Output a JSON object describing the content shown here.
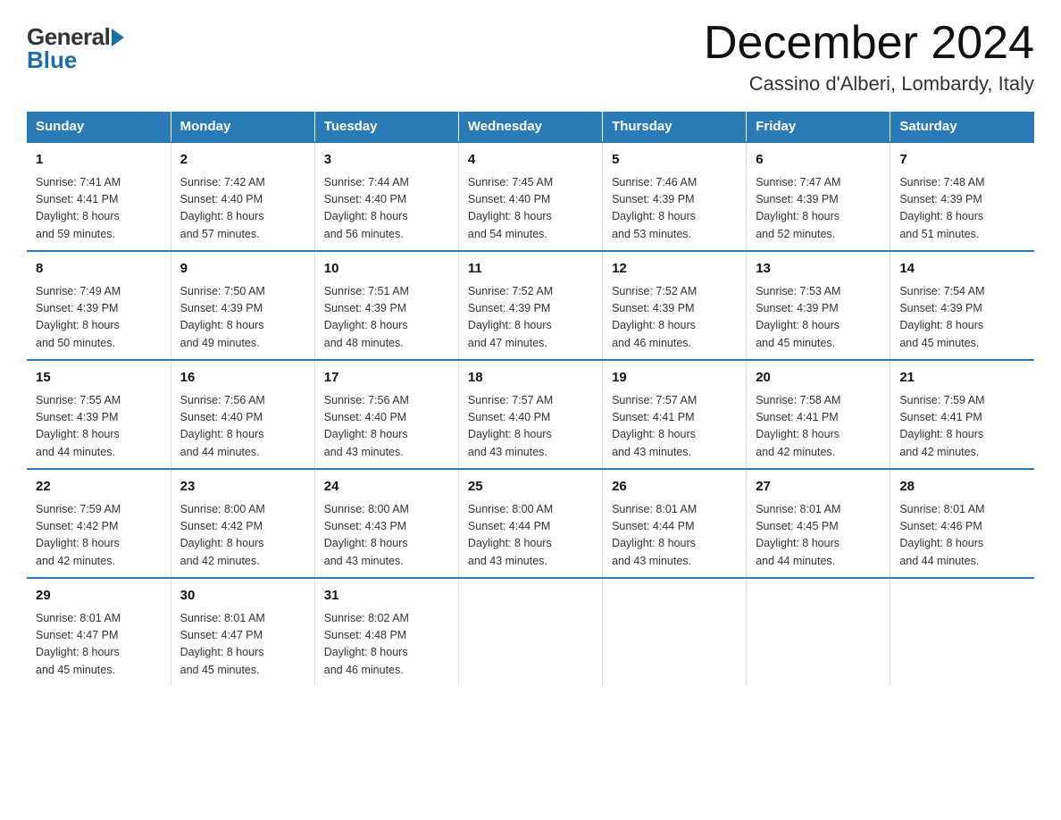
{
  "header": {
    "logo_general": "General",
    "logo_blue": "Blue",
    "month_title": "December 2024",
    "location": "Cassino d'Alberi, Lombardy, Italy"
  },
  "weekdays": [
    "Sunday",
    "Monday",
    "Tuesday",
    "Wednesday",
    "Thursday",
    "Friday",
    "Saturday"
  ],
  "weeks": [
    [
      {
        "day": "1",
        "sunrise": "7:41 AM",
        "sunset": "4:41 PM",
        "daylight": "8 hours and 59 minutes."
      },
      {
        "day": "2",
        "sunrise": "7:42 AM",
        "sunset": "4:40 PM",
        "daylight": "8 hours and 57 minutes."
      },
      {
        "day": "3",
        "sunrise": "7:44 AM",
        "sunset": "4:40 PM",
        "daylight": "8 hours and 56 minutes."
      },
      {
        "day": "4",
        "sunrise": "7:45 AM",
        "sunset": "4:40 PM",
        "daylight": "8 hours and 54 minutes."
      },
      {
        "day": "5",
        "sunrise": "7:46 AM",
        "sunset": "4:39 PM",
        "daylight": "8 hours and 53 minutes."
      },
      {
        "day": "6",
        "sunrise": "7:47 AM",
        "sunset": "4:39 PM",
        "daylight": "8 hours and 52 minutes."
      },
      {
        "day": "7",
        "sunrise": "7:48 AM",
        "sunset": "4:39 PM",
        "daylight": "8 hours and 51 minutes."
      }
    ],
    [
      {
        "day": "8",
        "sunrise": "7:49 AM",
        "sunset": "4:39 PM",
        "daylight": "8 hours and 50 minutes."
      },
      {
        "day": "9",
        "sunrise": "7:50 AM",
        "sunset": "4:39 PM",
        "daylight": "8 hours and 49 minutes."
      },
      {
        "day": "10",
        "sunrise": "7:51 AM",
        "sunset": "4:39 PM",
        "daylight": "8 hours and 48 minutes."
      },
      {
        "day": "11",
        "sunrise": "7:52 AM",
        "sunset": "4:39 PM",
        "daylight": "8 hours and 47 minutes."
      },
      {
        "day": "12",
        "sunrise": "7:52 AM",
        "sunset": "4:39 PM",
        "daylight": "8 hours and 46 minutes."
      },
      {
        "day": "13",
        "sunrise": "7:53 AM",
        "sunset": "4:39 PM",
        "daylight": "8 hours and 45 minutes."
      },
      {
        "day": "14",
        "sunrise": "7:54 AM",
        "sunset": "4:39 PM",
        "daylight": "8 hours and 45 minutes."
      }
    ],
    [
      {
        "day": "15",
        "sunrise": "7:55 AM",
        "sunset": "4:39 PM",
        "daylight": "8 hours and 44 minutes."
      },
      {
        "day": "16",
        "sunrise": "7:56 AM",
        "sunset": "4:40 PM",
        "daylight": "8 hours and 44 minutes."
      },
      {
        "day": "17",
        "sunrise": "7:56 AM",
        "sunset": "4:40 PM",
        "daylight": "8 hours and 43 minutes."
      },
      {
        "day": "18",
        "sunrise": "7:57 AM",
        "sunset": "4:40 PM",
        "daylight": "8 hours and 43 minutes."
      },
      {
        "day": "19",
        "sunrise": "7:57 AM",
        "sunset": "4:41 PM",
        "daylight": "8 hours and 43 minutes."
      },
      {
        "day": "20",
        "sunrise": "7:58 AM",
        "sunset": "4:41 PM",
        "daylight": "8 hours and 42 minutes."
      },
      {
        "day": "21",
        "sunrise": "7:59 AM",
        "sunset": "4:41 PM",
        "daylight": "8 hours and 42 minutes."
      }
    ],
    [
      {
        "day": "22",
        "sunrise": "7:59 AM",
        "sunset": "4:42 PM",
        "daylight": "8 hours and 42 minutes."
      },
      {
        "day": "23",
        "sunrise": "8:00 AM",
        "sunset": "4:42 PM",
        "daylight": "8 hours and 42 minutes."
      },
      {
        "day": "24",
        "sunrise": "8:00 AM",
        "sunset": "4:43 PM",
        "daylight": "8 hours and 43 minutes."
      },
      {
        "day": "25",
        "sunrise": "8:00 AM",
        "sunset": "4:44 PM",
        "daylight": "8 hours and 43 minutes."
      },
      {
        "day": "26",
        "sunrise": "8:01 AM",
        "sunset": "4:44 PM",
        "daylight": "8 hours and 43 minutes."
      },
      {
        "day": "27",
        "sunrise": "8:01 AM",
        "sunset": "4:45 PM",
        "daylight": "8 hours and 44 minutes."
      },
      {
        "day": "28",
        "sunrise": "8:01 AM",
        "sunset": "4:46 PM",
        "daylight": "8 hours and 44 minutes."
      }
    ],
    [
      {
        "day": "29",
        "sunrise": "8:01 AM",
        "sunset": "4:47 PM",
        "daylight": "8 hours and 45 minutes."
      },
      {
        "day": "30",
        "sunrise": "8:01 AM",
        "sunset": "4:47 PM",
        "daylight": "8 hours and 45 minutes."
      },
      {
        "day": "31",
        "sunrise": "8:02 AM",
        "sunset": "4:48 PM",
        "daylight": "8 hours and 46 minutes."
      },
      null,
      null,
      null,
      null
    ]
  ],
  "labels": {
    "sunrise": "Sunrise:",
    "sunset": "Sunset:",
    "daylight": "Daylight:"
  }
}
